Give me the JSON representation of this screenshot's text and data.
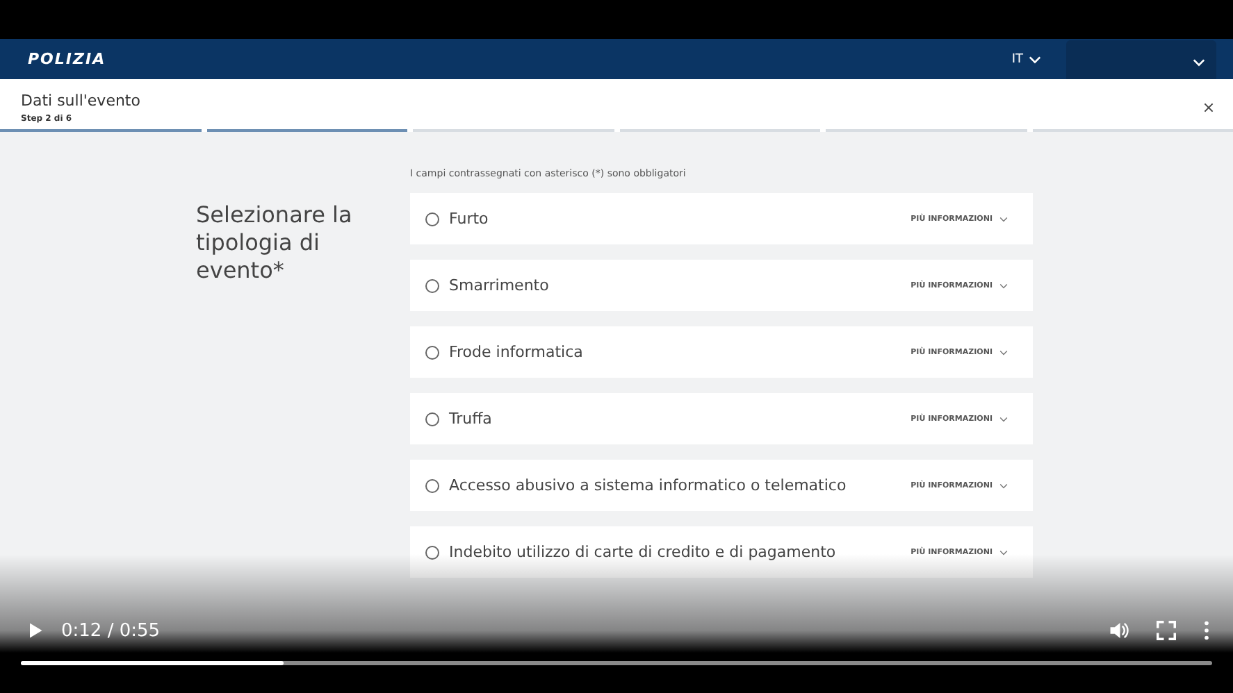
{
  "video_frame": {
    "header": {
      "logo": "POLIZIA",
      "language": "IT"
    },
    "step_header": {
      "title": "Dati sull'evento",
      "step": "Step 2 di 6",
      "steps": [
        {
          "done": true
        },
        {
          "done": true
        },
        {
          "done": false
        },
        {
          "done": false
        },
        {
          "done": false
        },
        {
          "done": false
        }
      ]
    },
    "required_note": "I campi contrassegnati con asterisco (*) sono obbligatori",
    "question": "Selezionare la tipologia di evento*",
    "options": [
      {
        "label": "Furto",
        "selected": false,
        "more": "PIÙ INFORMAZIONI"
      },
      {
        "label": "Smarrimento",
        "selected": false,
        "more": "PIÙ INFORMAZIONI"
      },
      {
        "label": "Frode informatica",
        "selected": false,
        "more": "PIÙ INFORMAZIONI"
      },
      {
        "label": "Truffa",
        "selected": false,
        "more": "PIÙ INFORMAZIONI"
      },
      {
        "label": "Accesso abusivo a sistema informatico o telematico",
        "selected": false,
        "more": "PIÙ INFORMAZIONI"
      },
      {
        "label": "Indebito utilizzo di carte di credito e di pagamento",
        "selected": false,
        "more": "PIÙ INFORMAZIONI"
      }
    ]
  },
  "player": {
    "time": "0:12 / 0:55",
    "level": 0.22
  }
}
